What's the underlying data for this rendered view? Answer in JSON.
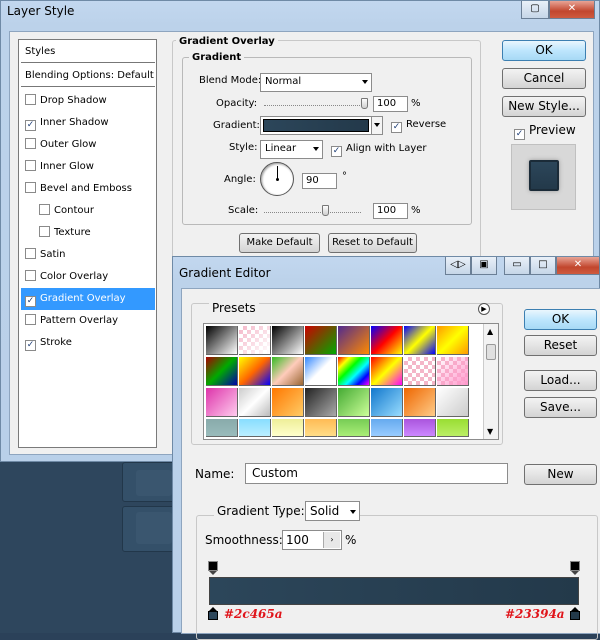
{
  "layer_style": {
    "title": "Layer Style",
    "styles_header": "Styles",
    "blending_options": "Blending Options: Default",
    "effects": [
      {
        "label": "Drop Shadow",
        "checked": false,
        "indent": false,
        "selected": false
      },
      {
        "label": "Inner Shadow",
        "checked": true,
        "indent": false,
        "selected": false
      },
      {
        "label": "Outer Glow",
        "checked": false,
        "indent": false,
        "selected": false
      },
      {
        "label": "Inner Glow",
        "checked": false,
        "indent": false,
        "selected": false
      },
      {
        "label": "Bevel and Emboss",
        "checked": false,
        "indent": false,
        "selected": false
      },
      {
        "label": "Contour",
        "checked": false,
        "indent": true,
        "selected": false
      },
      {
        "label": "Texture",
        "checked": false,
        "indent": true,
        "selected": false
      },
      {
        "label": "Satin",
        "checked": false,
        "indent": false,
        "selected": false
      },
      {
        "label": "Color Overlay",
        "checked": false,
        "indent": false,
        "selected": false
      },
      {
        "label": "Gradient Overlay",
        "checked": true,
        "indent": false,
        "selected": true
      },
      {
        "label": "Pattern Overlay",
        "checked": false,
        "indent": false,
        "selected": false
      },
      {
        "label": "Stroke",
        "checked": true,
        "indent": false,
        "selected": false
      }
    ],
    "section_title": "Gradient Overlay",
    "group_title": "Gradient",
    "blend_mode_label": "Blend Mode:",
    "blend_mode_value": "Normal",
    "opacity_label": "Opacity:",
    "opacity_value": "100",
    "opacity_fraction": 1.0,
    "percent": "%",
    "gradient_label": "Gradient:",
    "reverse_label": "Reverse",
    "reverse_checked": true,
    "style_label": "Style:",
    "style_value": "Linear",
    "align_label": "Align with Layer",
    "align_checked": true,
    "angle_label": "Angle:",
    "angle_value": "90",
    "degree": "°",
    "scale_label": "Scale:",
    "scale_value": "100",
    "scale_fraction": 0.6,
    "make_default": "Make Default",
    "reset_default": "Reset to Default",
    "ok": "OK",
    "cancel": "Cancel",
    "new_style": "New Style...",
    "preview_label": "Preview",
    "preview_checked": true
  },
  "gradient_editor": {
    "title": "Gradient Editor",
    "presets_label": "Presets",
    "ok": "OK",
    "reset": "Reset",
    "load": "Load...",
    "save": "Save...",
    "name_label": "Name:",
    "name_value": "Custom",
    "new_button": "New",
    "gradient_type_label": "Gradient Type:",
    "gradient_type_value": "Solid",
    "smoothness_label": "Smoothness:",
    "smoothness_value": "100",
    "percent": "%",
    "stop_left_color": "#2c465a",
    "stop_right_color": "#23394a",
    "annotation_left": "#2c465a",
    "annotation_right": "#23394a"
  },
  "colors": {
    "gradient_start": "#2c465a",
    "gradient_end": "#23394a",
    "selection": "#3399ff",
    "annotation": "#e0141a"
  }
}
